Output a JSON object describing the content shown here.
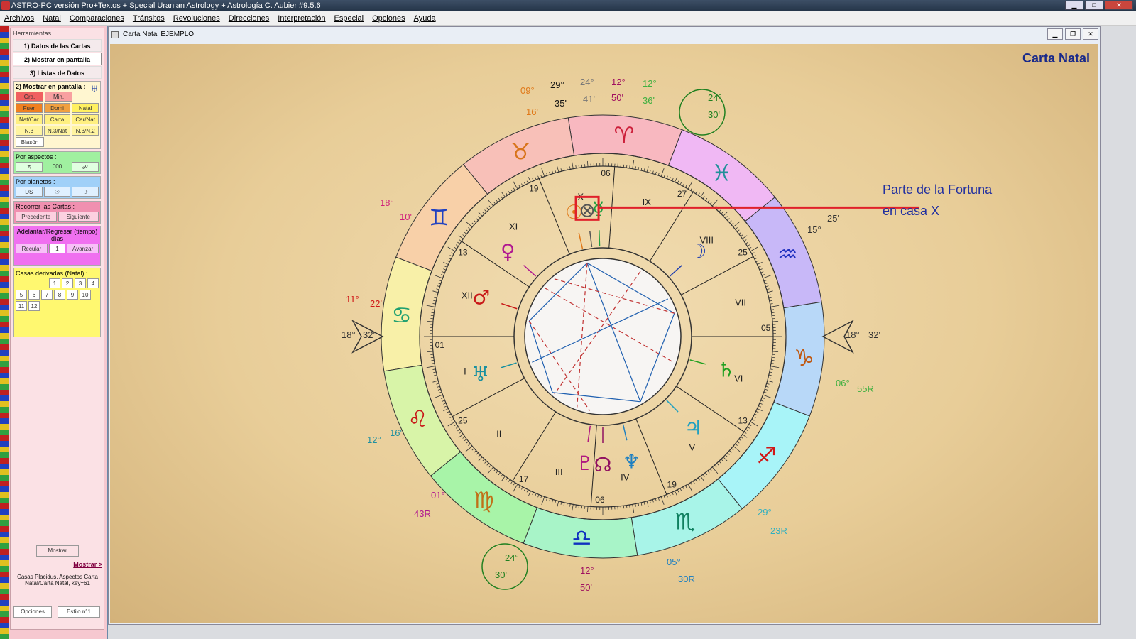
{
  "window": {
    "title": "ASTRO-PC versión Pro+Textos + Special Uranian Astrology + Astrología C. Aubier #9.5.6"
  },
  "menu": [
    "Archivos",
    "Natal",
    "Comparaciones",
    "Tránsitos",
    "Revoluciones",
    "Direcciones",
    "Interpretación",
    "Especial",
    "Opciones",
    "Ayuda"
  ],
  "sidebar": {
    "title": "Herramientas",
    "tabs": [
      "1) Datos de las Cartas",
      "2) Mostrar en pantalla",
      "3) Listas de Datos"
    ],
    "section": "2) Mostrar en pantalla :",
    "buttons_row1": [
      "Gra.",
      "Min."
    ],
    "buttons_row2": [
      "Fuer",
      "Domi",
      "Natal"
    ],
    "buttons_row3": [
      "Nat/Car",
      "Carta",
      "Car/Nat"
    ],
    "buttons_row4": [
      "N.3",
      "N.3/Nat",
      "N.3/N.2"
    ],
    "blason": "Blasón",
    "por_aspectos": "Por aspectos :",
    "aspect_value": "000",
    "aspect_btns": [
      "⚻",
      "☍"
    ],
    "por_planetas": "Por planetas :",
    "planet_btns": [
      "DS",
      "☉",
      "☽"
    ],
    "recorrer": "Recorrer las Cartas :",
    "precedente": "Precedente",
    "siguiente": "Siguiente",
    "adelantar": "Adelantar/Regresar (tiempo) días",
    "recular": "Recular",
    "days": "1",
    "avanzar": "Avanzar",
    "casas": "Casas derivadas (Natal) :",
    "casas_nums": [
      "1",
      "2",
      "3",
      "4",
      "5",
      "6",
      "7",
      "8",
      "9",
      "10",
      "11",
      "12"
    ],
    "mostrar": "Mostrar",
    "mostrar_link": "Mostrar >",
    "info": "Casas Placidus, Aspectos Carta Natal/Carta Natal, key=61",
    "opciones": "Opciones",
    "estilo": "Estilo n°1"
  },
  "document": {
    "title": "Carta Natal  EJEMPLO",
    "chart_title": "Carta Natal"
  },
  "annotation": {
    "line1": "Parte de la Fortuna",
    "line2": "en casa X"
  },
  "colors": {
    "accent": "#1a2a8a",
    "highlight": "#e0202a",
    "parchment": "#ecd3a3"
  },
  "chart": {
    "signs": [
      {
        "glyph": "♈",
        "color": "#cc1f3a"
      },
      {
        "glyph": "♉",
        "color": "#d8741a"
      },
      {
        "glyph": "♊",
        "color": "#2040c0"
      },
      {
        "glyph": "♋",
        "color": "#20a070"
      },
      {
        "glyph": "♌",
        "color": "#c81818"
      },
      {
        "glyph": "♍",
        "color": "#c07018"
      },
      {
        "glyph": "♎",
        "color": "#1030c0"
      },
      {
        "glyph": "♏",
        "color": "#108060"
      },
      {
        "glyph": "♐",
        "color": "#d01818"
      },
      {
        "glyph": "♑",
        "color": "#c05810"
      },
      {
        "glyph": "♒",
        "color": "#2030c0"
      },
      {
        "glyph": "♓",
        "color": "#20909a"
      }
    ],
    "planets": [
      {
        "glyph": "☉",
        "color": "#e07818"
      },
      {
        "glyph": "☽",
        "color": "#2040b0"
      },
      {
        "glyph": "☿",
        "color": "#20a040"
      },
      {
        "glyph": "♀",
        "color": "#b01890"
      },
      {
        "glyph": "♂",
        "color": "#c81818"
      },
      {
        "glyph": "♃",
        "color": "#20a0c0"
      },
      {
        "glyph": "♄",
        "color": "#20a020"
      },
      {
        "glyph": "♅",
        "color": "#1890a0"
      },
      {
        "glyph": "♆",
        "color": "#2080c0"
      },
      {
        "glyph": "♇",
        "color": "#b01880"
      },
      {
        "glyph": "☊",
        "color": "#901060"
      },
      {
        "glyph": "⊗",
        "color": "#555"
      }
    ],
    "houses": [
      "I",
      "II",
      "III",
      "IV",
      "V",
      "VI",
      "VII",
      "VIII",
      "IX",
      "X",
      "XI",
      "XII"
    ],
    "cusp_labels": [
      {
        "t": "09°",
        "c": "#e07818"
      },
      {
        "t": "16'",
        "c": "#e07818"
      },
      {
        "t": "29°",
        "c": "#111"
      },
      {
        "t": "35'",
        "c": "#111"
      },
      {
        "t": "24°",
        "c": "#777"
      },
      {
        "t": "41'",
        "c": "#777"
      },
      {
        "t": "12°",
        "c": "#a01060"
      },
      {
        "t": "50'",
        "c": "#a01060"
      },
      {
        "t": "12°",
        "c": "#40b040"
      },
      {
        "t": "36'",
        "c": "#40b040"
      },
      {
        "t": "24°",
        "c": "#208020"
      },
      {
        "t": "30'",
        "c": "#208020"
      },
      {
        "t": "18°",
        "c": "#d0207a"
      },
      {
        "t": "10'",
        "c": "#d0207a"
      },
      {
        "t": "25'",
        "c": "#333"
      },
      {
        "t": "15°",
        "c": "#333"
      },
      {
        "t": "11°",
        "c": "#d01818"
      },
      {
        "t": "22'",
        "c": "#d01818"
      },
      {
        "t": "18°",
        "c": "#333"
      },
      {
        "t": "32'",
        "c": "#333"
      },
      {
        "t": "18°",
        "c": "#333"
      },
      {
        "t": "32'",
        "c": "#333"
      },
      {
        "t": "06°",
        "c": "#40b040"
      },
      {
        "t": "55R",
        "c": "#40b040"
      },
      {
        "t": "12°",
        "c": "#2090a0"
      },
      {
        "t": "16'",
        "c": "#2090a0"
      },
      {
        "t": "01°",
        "c": "#b01890"
      },
      {
        "t": "43R",
        "c": "#b01890"
      },
      {
        "t": "29°",
        "c": "#30b0c0"
      },
      {
        "t": "23R",
        "c": "#30b0c0"
      },
      {
        "t": "24°",
        "c": "#208020"
      },
      {
        "t": "30'",
        "c": "#208020"
      },
      {
        "t": "12°",
        "c": "#a01060"
      },
      {
        "t": "50'",
        "c": "#a01060"
      },
      {
        "t": "05°",
        "c": "#2080c0"
      },
      {
        "t": "30R",
        "c": "#2080c0"
      }
    ],
    "ring_numbers": [
      "01",
      "25",
      "17",
      "06",
      "19",
      "13",
      "05",
      "25",
      "27",
      "06",
      "19",
      "13"
    ]
  }
}
